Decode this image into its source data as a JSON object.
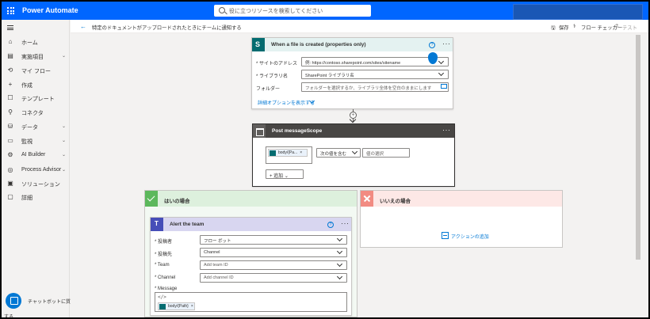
{
  "topbar": {
    "app_name": "Power Automate",
    "search_placeholder": "役に立つリソースを検索してください"
  },
  "nav": {
    "items": [
      {
        "label": "ホーム",
        "icon": "home-icon",
        "glyph": "⌂"
      },
      {
        "label": "実施項目",
        "icon": "clipboard-icon",
        "glyph": "▤",
        "chevron": "⌄"
      },
      {
        "label": "マイ フロー",
        "icon": "flow-icon",
        "glyph": "⟲"
      },
      {
        "label": "作成",
        "icon": "plus-icon",
        "glyph": "+"
      },
      {
        "label": "テンプレート",
        "icon": "template-icon",
        "glyph": "☐"
      },
      {
        "label": "コネクタ",
        "icon": "connector-icon",
        "glyph": "⚲"
      },
      {
        "label": "データ",
        "icon": "database-icon",
        "glyph": "⛁",
        "chevron": "⌄"
      },
      {
        "label": "監視",
        "icon": "monitor-icon",
        "glyph": "▭",
        "chevron": "⌄"
      },
      {
        "label": "AI Builder",
        "icon": "ai-builder-icon",
        "glyph": "⚙",
        "chevron": "⌄"
      },
      {
        "label": "Process Advisor",
        "icon": "process-advisor-icon",
        "glyph": "◎",
        "chevron": "⌄"
      },
      {
        "label": "ソリューション",
        "icon": "solution-icon",
        "glyph": "▣"
      },
      {
        "label": "詳細",
        "icon": "more-icon",
        "glyph": "▢"
      }
    ],
    "chatbot_label": "チャットボットに質問",
    "chatbot_label_cont": "する"
  },
  "cmdbar": {
    "flow_title": "特定のドキュメントがアップロードされたときにチームに通知する",
    "save": "保存",
    "checker": "フロー チェッカー",
    "test": "テスト"
  },
  "trigger": {
    "title": "When a file is created (properties only)",
    "site_label": "* サイトのアドレス",
    "site_value": "例: https://contoso.sharepoint.com/sites/sitename",
    "library_label": "* ライブラリ名",
    "library_value": "SharePoint ライブラリ名",
    "folder_label": "フォルダー",
    "folder_placeholder": "フォルダーを選択するか、ライブラリ全体を空白のままにします",
    "advanced": "詳細オプションを表示する"
  },
  "scope": {
    "title": "Post messageScope",
    "token": "body/{Pa...",
    "operator": "次の値を含む",
    "value_placeholder": "値の選択",
    "add": "追加"
  },
  "yes_branch": {
    "title": "はいの場合"
  },
  "no_branch": {
    "title": "いいえの場合",
    "add_action": "アクションの追加"
  },
  "teams": {
    "title": "Alert the team",
    "poster_label": "* 投稿者",
    "poster_value": "フロー ボット",
    "post_in_label": "* 投稿先",
    "post_in_value": "Channel",
    "team_label": "* Team",
    "team_placeholder": "Add team ID",
    "channel_label": "* Channel",
    "channel_placeholder": "Add channel ID",
    "message_label": "* Message",
    "message_token": "body/{Path}",
    "code_glyph": "</>"
  }
}
